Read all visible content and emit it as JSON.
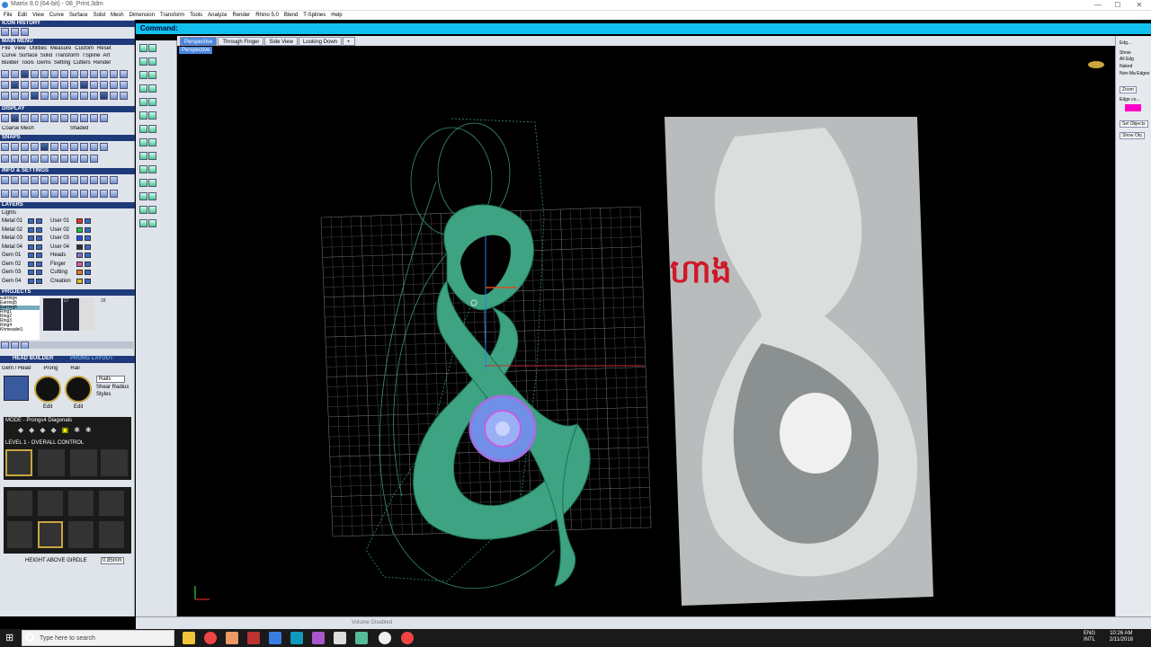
{
  "window": {
    "title": "Matrix 8.0 (64-bit) - 08_Print.3dm",
    "minimize": "—",
    "maximize": "☐",
    "close": "✕"
  },
  "menu": [
    "File",
    "Edit",
    "View",
    "Curve",
    "Surface",
    "Solid",
    "Mesh",
    "Dimension",
    "Transform",
    "Tools",
    "Analyze",
    "Render",
    "Rhino 5.0",
    "Blend",
    "T-Splines",
    "Help"
  ],
  "left_panel": {
    "icon_history": "ICON HISTORY",
    "main_menu": "MAIN MENU",
    "main_menu_row1": [
      "File",
      "View",
      "Utilities",
      "Measure",
      "Custom",
      "Reset"
    ],
    "main_menu_row2": [
      "Curve",
      "Surface",
      "Solid",
      "Transform",
      "TSpline",
      "Art"
    ],
    "main_menu_row3": [
      "Builder",
      "Tools",
      "Gems",
      "Setting",
      "Cutters",
      "Render"
    ],
    "display": "DISPLAY",
    "display_modes": [
      "Coarse Mesh",
      "Shaded"
    ],
    "snaps": "SNAPS",
    "info_settings": "INFO & SETTINGS",
    "layers": "LAYERS",
    "lights": "Lights",
    "layer_rows": [
      {
        "left": "Metal 01",
        "right": "User 01",
        "color": "#e83030"
      },
      {
        "left": "Metal 02",
        "right": "User 02",
        "color": "#20c040"
      },
      {
        "left": "Metal 03",
        "right": "User 03",
        "color": "#2050e0"
      },
      {
        "left": "Metal 04",
        "right": "User 04",
        "color": "#303030"
      },
      {
        "left": "Gem 01",
        "right": "Heads",
        "color": "#8c6ed8"
      },
      {
        "left": "Gem 02",
        "right": "Finger",
        "color": "#e05aa0"
      },
      {
        "left": "Gem 03",
        "right": "Cutting",
        "color": "#e07a20"
      },
      {
        "left": "Gem 04",
        "right": "Creation",
        "color": "#e0c020"
      }
    ],
    "projects": "PROJECTS",
    "project_items": [
      "Earring4",
      "Earring5",
      "Earring6",
      "Ring1",
      "Ring2",
      "Ring3",
      "Ring4",
      "Khmeadet1"
    ],
    "thumb_numbers": [
      "27",
      "28"
    ],
    "head_builder": "HEAD BUILDER",
    "prong_layout": "PRONG LAYOUT",
    "builder_labels": [
      "Gem / Head",
      "Prong",
      "Rail"
    ],
    "rails_label": "Rails",
    "shear_radius": "Shear Radius",
    "styles_label": "Styles",
    "edit_labels": [
      "Edit",
      "Edit"
    ],
    "mode_label": "MODE - Prongs4 Diagonals",
    "level_label": "LEVEL 1 - OVERALL CONTROL",
    "height_label": "HEIGHT ABOVE GIRDLE",
    "height_value": "0.85mm"
  },
  "command": {
    "label": "Command:"
  },
  "view_tabs": [
    "Perspective",
    "Through Finger",
    "Side View",
    "Looking Down"
  ],
  "viewport": {
    "label": "Perspective"
  },
  "right_panel": [
    "Edg...",
    "Show",
    "All Edg",
    "Naked",
    "Non-Ma Edges",
    "Zoom",
    "Edge co...",
    "Sel Objects",
    "Show Obj"
  ],
  "edge_color": "#ff00c8",
  "status": "Volume Disabled",
  "taskbar": {
    "search_placeholder": "Type here to search",
    "lang": "ENG",
    "lang2": "INTL",
    "time": "10:26 AM",
    "date": "2/11/2018"
  },
  "photo": {
    "text": "ហាង"
  }
}
